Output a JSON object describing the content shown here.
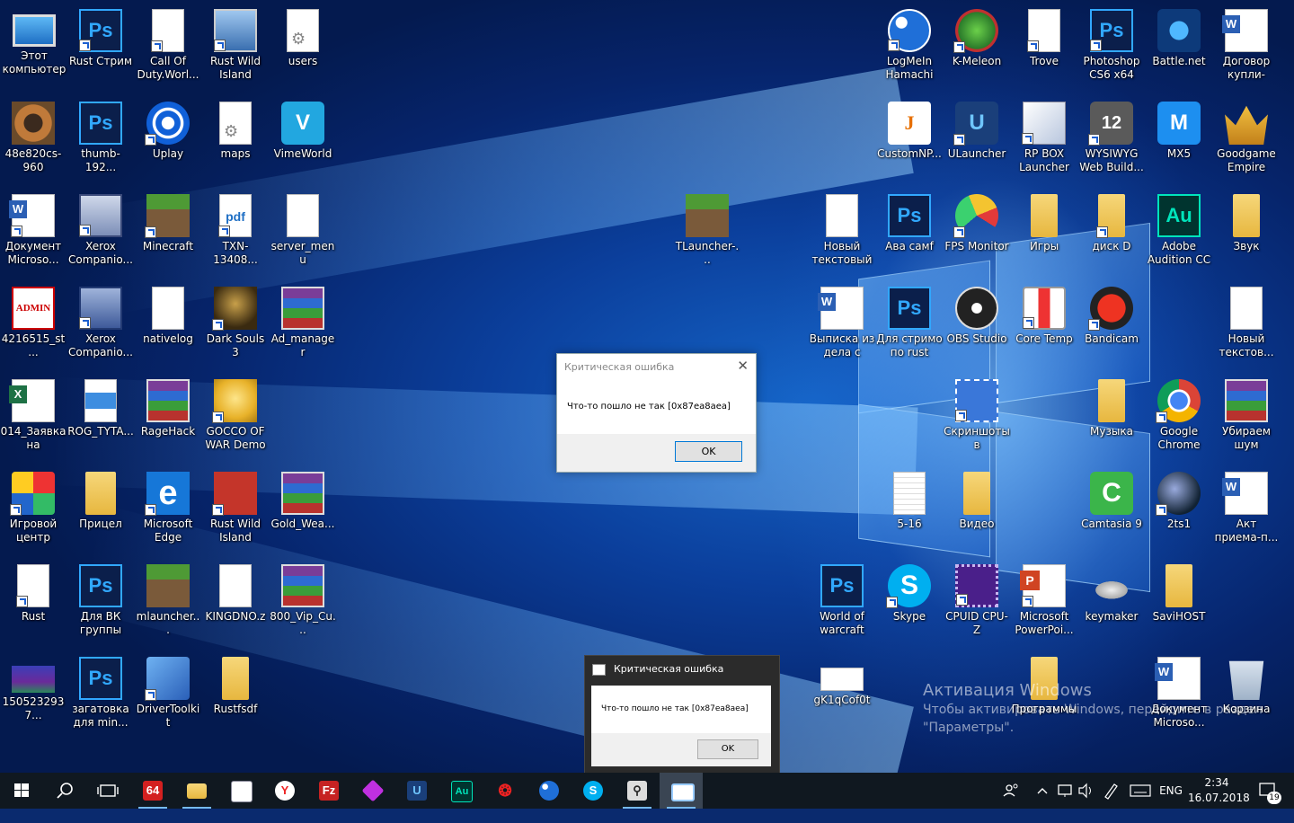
{
  "desktop_icons": {
    "this_pc": "Этот компьютер",
    "rust_stream": "Rust Стрим",
    "call_of_duty": "Call Of Duty.Worl...",
    "rust_wild_setup": "Rust Wild Island Setup",
    "users": "users",
    "logmein": "LogMeIn Hamachi",
    "kmeleon": "K-Meleon",
    "trove": "Trove",
    "photoshop": "Photoshop CS6 x64",
    "battlenet": "Battle.net",
    "dogovor": "Договор купли-про...",
    "img_48e": "48e820cs-960",
    "thumb": "thumb-192...",
    "uplay": "Uplay",
    "maps": "maps",
    "vimeworld": "VimeWorld",
    "customnp": "CustomNP...",
    "ulauncher": "ULauncher",
    "rpbox": "RP BOX Launcher",
    "wysiwyg": "WYSIWYG Web Build...",
    "mx5": "MX5",
    "goodgame": "Goodgame Empire",
    "doc_ms": "Документ Microso...",
    "xerox1": "Xerox Companio...",
    "minecraft": "Minecraft",
    "txn": "TXN-13408...",
    "server_menu": "server_menu",
    "tlauncher": "TLauncher-...",
    "new_txt": "Новый текстовый ...",
    "ava": "Ава самf",
    "fps": "FPS Monitor",
    "games": "Игры",
    "diskd": "диск D",
    "audition": "Adobe Audition CC",
    "zvuk": "Звук",
    "admin": "4216515_st...",
    "xerox2": "Xerox Companio...",
    "nativelog": "nativelog",
    "darksouls": "Dark Souls 3",
    "admanager": "Ad_manager",
    "vypiska": "Выписка из дела с про...",
    "dlya_strima": "Для стримо по rust",
    "obs": "OBS Studio",
    "coretemp": "Core Temp",
    "bandicam": "Bandicam",
    "new_txt2": "Новый текстов...",
    "zayavka": "014_Заявка на очеред...",
    "rog": "ROG_TYTA...",
    "ragehack": "RageHack",
    "gocco": "GOCCO OF WAR Demo",
    "screenshots": "Скриншоты в Яндекс.Д...",
    "music": "Музыка",
    "chrome": "Google Chrome",
    "noise": "Убираем шум",
    "igrovoy": "Игровой центр",
    "pricel": "Прицел",
    "edge": "Microsoft Edge",
    "rust_wild": "Rust Wild Island",
    "gold_wea": "Gold_Wea...",
    "f516": "5-16",
    "video": "Видео",
    "camtasia": "Camtasia 9",
    "ts1": "2ts1",
    "akt": "Акт приема-п...",
    "rust": "Rust",
    "vk": "Для ВК группы",
    "mlauncher": "mlauncher...",
    "kingdno": "KINGDNO.z",
    "vip": "800_Vip_Cu...",
    "wow": "World of warcraft",
    "skype": "Skype",
    "cpuid": "CPUID CPU-Z",
    "powerpoint": "Microsoft PowerPoi...",
    "keymaker": "keymaker",
    "savihost": "SaviHOST",
    "img_1505": "1505232937...",
    "zagotovka": "загатовка для min...",
    "drivertoolkit": "DriverToolkit",
    "rustfsdf": "Rustfsdf",
    "gk1q": "gK1qCof0t",
    "programmy": "Программы",
    "doc_ms2": "Документ Microso...",
    "recycle": "Корзина"
  },
  "dialog_main": {
    "title": "Критическая ошибка",
    "message": "Что-то пошло не так [0x87ea8aea]",
    "ok": "OK"
  },
  "dialog_second": {
    "title": "Критическая ошибка",
    "message": "Что-то пошло не так [0x87ea8aea]",
    "ok": "OK"
  },
  "watermark": {
    "line1": "Активация Windows",
    "line2": "Чтобы активировать Windows, перейдите в раздел",
    "line3": "\"Параметры\"."
  },
  "taskbar": {
    "aida": "64",
    "language": "ENG",
    "time": "2:34",
    "date": "16.07.2018",
    "notifications": "19"
  },
  "colors": {
    "accent": "#0078d7",
    "taskbar_bg": "#101820",
    "desktop_bg": "#0b3f9c"
  }
}
